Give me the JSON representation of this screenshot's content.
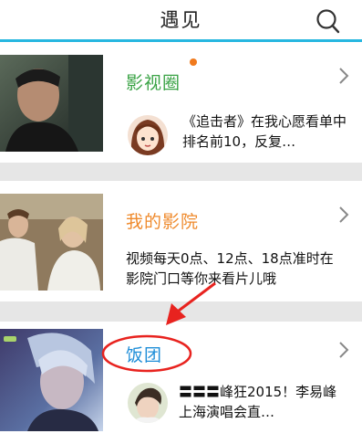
{
  "header": {
    "title": "遇见",
    "search_icon": "search-icon"
  },
  "colors": {
    "accent_line": "#27b7e0",
    "badge": "#f07a1d",
    "annotation": "#e8231f"
  },
  "cards": [
    {
      "title": "影视圈",
      "title_color": "#3aa345",
      "has_badge": true,
      "desc": "《追击者》在我心愿看单中排名前10，反复…"
    },
    {
      "title": "我的影院",
      "title_color": "#ef8a2c",
      "desc": "视频每天0点、12点、18点准时在影院门口等你来看片儿哦"
    },
    {
      "title": "饭团",
      "title_color": "#1f8ed8",
      "desc": "〓〓〓峰狂2015！李易峰上海演唱会直…"
    }
  ]
}
